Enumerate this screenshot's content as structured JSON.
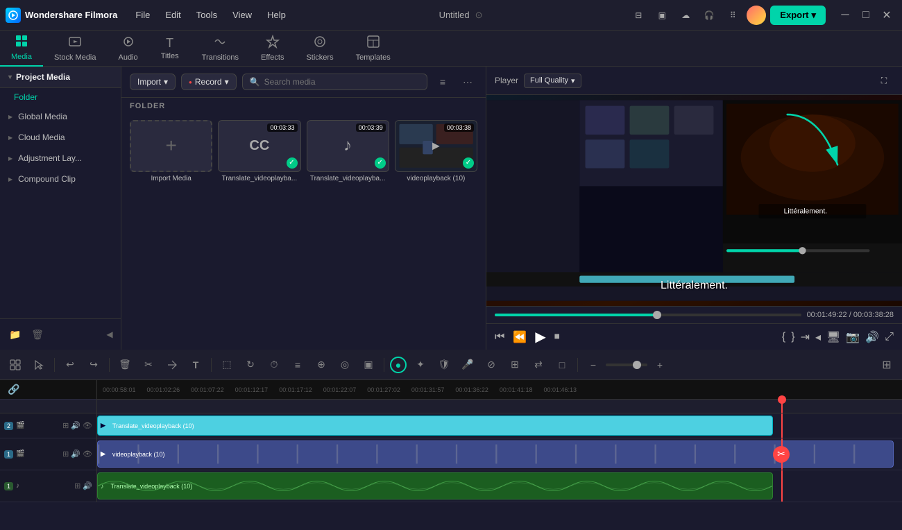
{
  "app": {
    "name": "Wondershare Filmora",
    "title": "Untitled",
    "logo_text": "W"
  },
  "menu": {
    "items": [
      "File",
      "Edit",
      "Tools",
      "View",
      "Help"
    ]
  },
  "toolbar": {
    "tabs": [
      {
        "id": "media",
        "label": "Media",
        "icon": "▣",
        "active": true
      },
      {
        "id": "stock",
        "label": "Stock Media",
        "icon": "🎬"
      },
      {
        "id": "audio",
        "label": "Audio",
        "icon": "♪"
      },
      {
        "id": "titles",
        "label": "Titles",
        "icon": "T"
      },
      {
        "id": "transitions",
        "label": "Transitions",
        "icon": "⇄"
      },
      {
        "id": "effects",
        "label": "Effects",
        "icon": "✦"
      },
      {
        "id": "stickers",
        "label": "Stickers",
        "icon": "◎"
      },
      {
        "id": "templates",
        "label": "Templates",
        "icon": "⊞"
      }
    ],
    "export_label": "Export"
  },
  "sidebar": {
    "header": "Project Media",
    "folder_label": "Folder",
    "items": [
      {
        "label": "Global Media"
      },
      {
        "label": "Cloud Media"
      },
      {
        "label": "Adjustment Lay..."
      },
      {
        "label": "Compound Clip"
      }
    ]
  },
  "media_panel": {
    "import_label": "Import",
    "record_label": "Record",
    "search_placeholder": "Search media",
    "folder_section": "FOLDER",
    "items": [
      {
        "type": "import",
        "label": "Import Media",
        "duration": null
      },
      {
        "type": "video",
        "label": "Translate_videoplayba...",
        "duration": "00:03:33",
        "checked": true
      },
      {
        "type": "audio",
        "label": "Translate_videoplayba...",
        "duration": "00:03:39",
        "checked": true
      },
      {
        "type": "video",
        "label": "videoplayback (10)",
        "duration": "00:03:38",
        "checked": true
      }
    ]
  },
  "player": {
    "label": "Player",
    "quality": "Full Quality",
    "subtitle": "Littéralement.",
    "current_time": "00:01:49:22",
    "total_time": "00:03:38:28",
    "progress_pct": 53
  },
  "timeline": {
    "ruler_marks": [
      "00:00:58:01",
      "00:01:02:26",
      "00:01:07:22",
      "00:01:12:17",
      "00:01:17:12",
      "00:01:22:07",
      "00:01:27:02",
      "00:01:31:57",
      "00:01:36:22",
      "00:01:41:18",
      "00:01:46:13"
    ],
    "tracks": [
      {
        "id": "video2",
        "icon": "🎬",
        "number": "2",
        "type": "video",
        "clips": [
          {
            "label": "Translate_videoplayback (10)",
            "color": "#4dd0e1",
            "left": "0%",
            "width": "84%"
          }
        ]
      },
      {
        "id": "video1",
        "icon": "🎬",
        "number": "1",
        "type": "video",
        "clips": [
          {
            "label": "videoplayback (10)",
            "color": "#5c6bc0",
            "left": "0%",
            "width": "99%"
          }
        ]
      },
      {
        "id": "audio1",
        "icon": "♪",
        "number": "1",
        "type": "audio",
        "clips": [
          {
            "label": "Translate_videoplayback (10)",
            "color": "#2e7d32",
            "left": "0%",
            "width": "84%"
          }
        ]
      }
    ]
  }
}
